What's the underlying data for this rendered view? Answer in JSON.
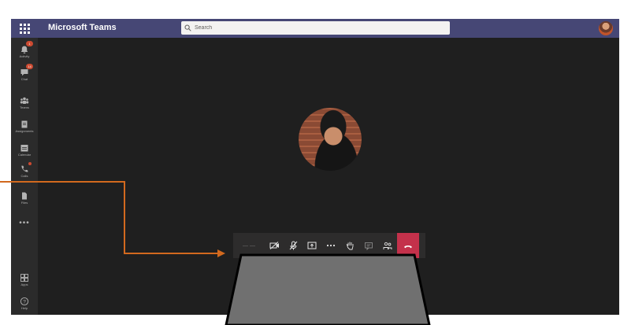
{
  "app": {
    "title": "Microsoft Teams"
  },
  "search": {
    "placeholder": "Search"
  },
  "rail": {
    "items": [
      {
        "label": "Activity",
        "icon": "bell-icon",
        "badge": "1"
      },
      {
        "label": "Chat",
        "icon": "chat-icon",
        "badge": "14"
      },
      {
        "label": "Teams",
        "icon": "teams-icon"
      },
      {
        "label": "Assignments",
        "icon": "assignments-icon"
      },
      {
        "label": "Calendar",
        "icon": "calendar-icon"
      },
      {
        "label": "Calls",
        "icon": "phone-icon"
      },
      {
        "label": "Files",
        "icon": "files-icon"
      }
    ],
    "more": "•••",
    "bottom": [
      {
        "label": "Apps",
        "icon": "apps-icon"
      },
      {
        "label": "Help",
        "icon": "help-icon"
      }
    ]
  },
  "toolbar": {
    "timer": "— —",
    "buttons": [
      "camera-off-icon",
      "mic-off-icon",
      "share-screen-icon",
      "more-icon",
      "raise-hand-icon",
      "chat-icon",
      "participants-icon"
    ],
    "hangup_icon": "hang-up-icon"
  },
  "colors": {
    "titlebar": "#464775",
    "stage": "#1f1f1f",
    "rail": "#2b2b2b",
    "toolbar": "#2d2c2c",
    "hangup": "#c4314b",
    "annotation_arrow": "#d2691e",
    "overlay_shape": "#707070"
  }
}
